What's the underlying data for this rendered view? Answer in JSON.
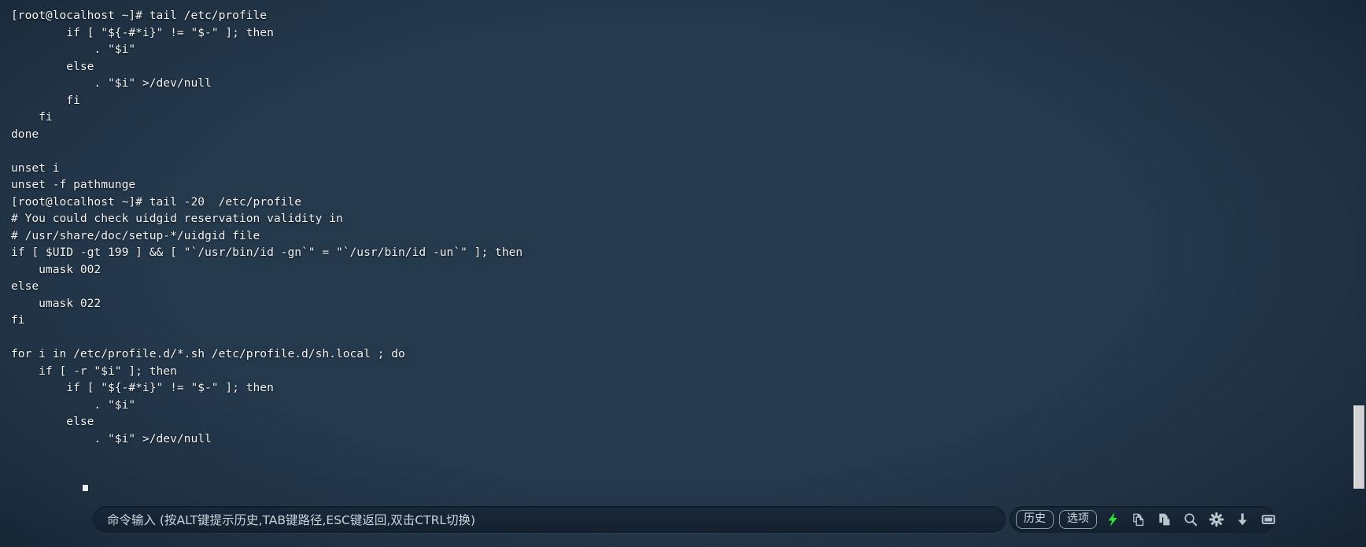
{
  "window": {
    "kind": "ssh-terminal",
    "background_color": "#3d6a86",
    "text_color": "#f2f4f5"
  },
  "terminal": {
    "lines": [
      "[root@localhost ~]# tail /etc/profile",
      "        if [ \"${-#*i}\" != \"$-\" ]; then",
      "            . \"$i\"",
      "        else",
      "            . \"$i\" >/dev/null",
      "        fi",
      "    fi",
      "done",
      "",
      "unset i",
      "unset -f pathmunge",
      "[root@localhost ~]# tail -20  /etc/profile",
      "# You could check uidgid reservation validity in",
      "# /usr/share/doc/setup-*/uidgid file",
      "if [ $UID -gt 199 ] && [ \"`/usr/bin/id -gn`\" = \"`/usr/bin/id -un`\" ]; then",
      "    umask 002",
      "else",
      "    umask 022",
      "fi",
      "",
      "for i in /etc/profile.d/*.sh /etc/profile.d/sh.local ; do",
      "    if [ -r \"$i\" ]; then",
      "        if [ \"${-#*i}\" != \"$-\" ]; then",
      "            . \"$i\"",
      "        else",
      "            . \"$i\" >/dev/null"
    ]
  },
  "command_bar": {
    "input": {
      "value": "",
      "placeholder": "命令输入 (按ALT键提示历史,TAB键路径,ESC键返回,双击CTRL切换)"
    },
    "buttons": [
      {
        "label": "历史",
        "name": "history-button"
      },
      {
        "label": "选项",
        "name": "options-button"
      }
    ],
    "icons": [
      {
        "name": "lightning-icon",
        "title": "快速命令",
        "color": "#2ce23c"
      },
      {
        "name": "copy-icon",
        "title": "复制",
        "color": "#b9c4cc"
      },
      {
        "name": "paste-icon",
        "title": "粘贴",
        "color": "#b9c4cc"
      },
      {
        "name": "search-icon",
        "title": "搜索",
        "color": "#b9c4cc"
      },
      {
        "name": "gear-icon",
        "title": "设置",
        "color": "#b9c4cc"
      },
      {
        "name": "download-icon",
        "title": "下载",
        "color": "#b9c4cc"
      },
      {
        "name": "window-icon",
        "title": "窗口",
        "color": "#b9c4cc"
      }
    ]
  },
  "scrollbar": {
    "thumb_color": "#d3d3d3",
    "position_percent": 80
  }
}
